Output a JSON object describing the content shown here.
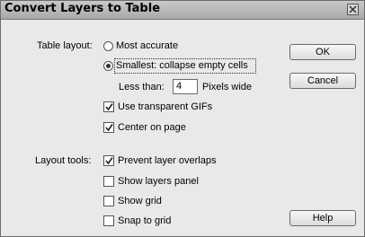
{
  "window": {
    "title": "Convert Layers to Table"
  },
  "table_layout": {
    "group_label": "Table layout:",
    "most_accurate": {
      "label": "Most accurate",
      "checked": false
    },
    "smallest": {
      "label": "Smallest: collapse empty cells",
      "checked": true
    },
    "less_than_label": "Less than:",
    "less_than_value": "4",
    "pixels_label": "Pixels wide",
    "use_transparent_gifs": {
      "label": "Use transparent GIFs",
      "checked": true
    },
    "center_on_page": {
      "label": "Center on page",
      "checked": true
    }
  },
  "layout_tools": {
    "group_label": "Layout tools:",
    "prevent_overlaps": {
      "label": "Prevent layer overlaps",
      "checked": true
    },
    "show_layers_panel": {
      "label": "Show layers panel",
      "checked": false
    },
    "show_grid": {
      "label": "Show grid",
      "checked": false
    },
    "snap_to_grid": {
      "label": "Snap to grid",
      "checked": false
    }
  },
  "buttons": {
    "ok": "OK",
    "cancel": "Cancel",
    "help": "Help"
  }
}
